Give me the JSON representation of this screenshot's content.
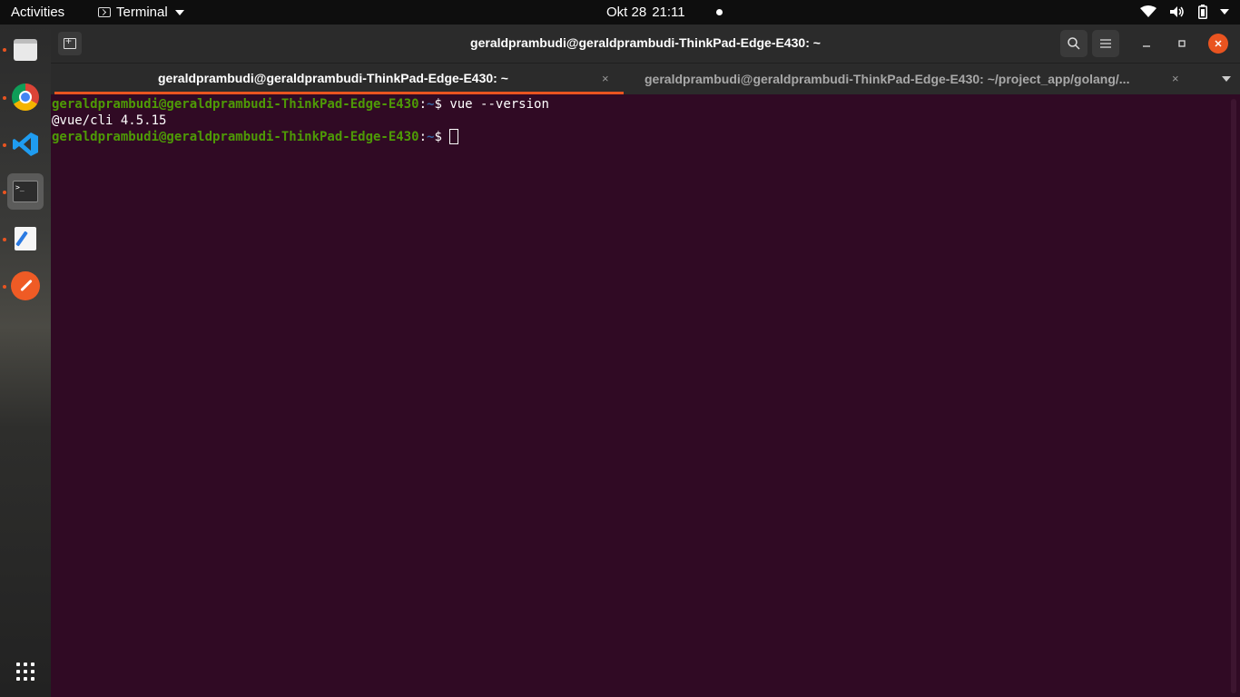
{
  "topbar": {
    "activities": "Activities",
    "app_name": "Terminal",
    "date": "Okt 28",
    "time": "21:11"
  },
  "dock": {
    "items": [
      {
        "name": "files",
        "running": true
      },
      {
        "name": "chrome",
        "running": true
      },
      {
        "name": "vscode",
        "running": true
      },
      {
        "name": "terminal",
        "running": true,
        "active": true
      },
      {
        "name": "text-editor",
        "running": true
      },
      {
        "name": "postman",
        "running": true
      }
    ],
    "terminal_glyph": ">_"
  },
  "window": {
    "title": "geraldprambudi@geraldprambudi-ThinkPad-Edge-E430: ~",
    "tabs": [
      {
        "label": "geraldprambudi@geraldprambudi-ThinkPad-Edge-E430: ~",
        "active": true
      },
      {
        "label": "geraldprambudi@geraldprambudi-ThinkPad-Edge-E430: ~/project_app/golang/...",
        "active": false
      }
    ],
    "close_glyph": "×"
  },
  "terminal": {
    "lines": [
      {
        "user": "geraldprambudi@geraldprambudi-ThinkPad-Edge-E430",
        "sep": ":",
        "path": "~",
        "symbol": "$ ",
        "command": "vue --version"
      },
      {
        "output": "@vue/cli 4.5.15"
      },
      {
        "user": "geraldprambudi@geraldprambudi-ThinkPad-Edge-E430",
        "sep": ":",
        "path": "~",
        "symbol": "$ ",
        "command": ""
      }
    ]
  },
  "colors": {
    "terminal_bg": "#300a24",
    "prompt_user": "#4e9a06",
    "prompt_path": "#3465a4",
    "accent": "#e95420"
  }
}
